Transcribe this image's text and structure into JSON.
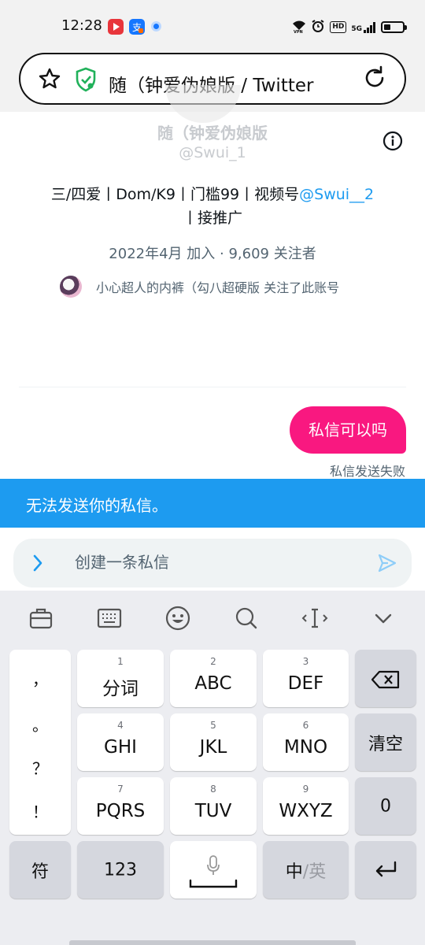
{
  "status_bar": {
    "time": "12:28",
    "right_badges": [
      "HD",
      "5G"
    ],
    "battery_level_percent": 35,
    "icons": [
      "video-app-icon",
      "payment-app-icon",
      "notification-dot-icon",
      "vpn-icon",
      "alarm-icon",
      "signal-icon",
      "battery-icon"
    ]
  },
  "browser": {
    "url_text": "随（钟爱伪娘版 / Twitter",
    "icons": [
      "star-icon",
      "shield-check-icon",
      "reload-icon"
    ]
  },
  "profile": {
    "name": "随（钟爱伪娘版",
    "handle": "@Swui_1",
    "bio_text": "三/四爱丨Dom/K9丨门槛99丨视频号",
    "bio_link": "@Swui__2",
    "bio_text_2": "丨接推广",
    "meta": "2022年4月 加入 · 9,609 关注者",
    "followed_by": "小心超人的内裤（勾八超硬版 关注了此账号"
  },
  "conversation": {
    "message": "私信可以吗",
    "status": "私信发送失败",
    "error_banner": "无法发送你的私信。"
  },
  "composer": {
    "placeholder": "创建一条私信"
  },
  "keyboard": {
    "punctuation": [
      "，",
      "。",
      "？",
      "！"
    ],
    "keys": [
      {
        "num": "1",
        "label": "分词"
      },
      {
        "num": "2",
        "label": "ABC"
      },
      {
        "num": "3",
        "label": "DEF"
      },
      {
        "num": "4",
        "label": "GHI"
      },
      {
        "num": "5",
        "label": "JKL"
      },
      {
        "num": "6",
        "label": "MNO"
      },
      {
        "num": "7",
        "label": "PQRS"
      },
      {
        "num": "8",
        "label": "TUV"
      },
      {
        "num": "9",
        "label": "WXYZ"
      }
    ],
    "clear_label": "清空",
    "zero_label": "0",
    "symbol_label": "符",
    "number_label": "123",
    "lang_primary": "中",
    "lang_secondary": "/英",
    "colors": {
      "accent": "#1d9bf0",
      "bubble": "#f91880"
    }
  }
}
